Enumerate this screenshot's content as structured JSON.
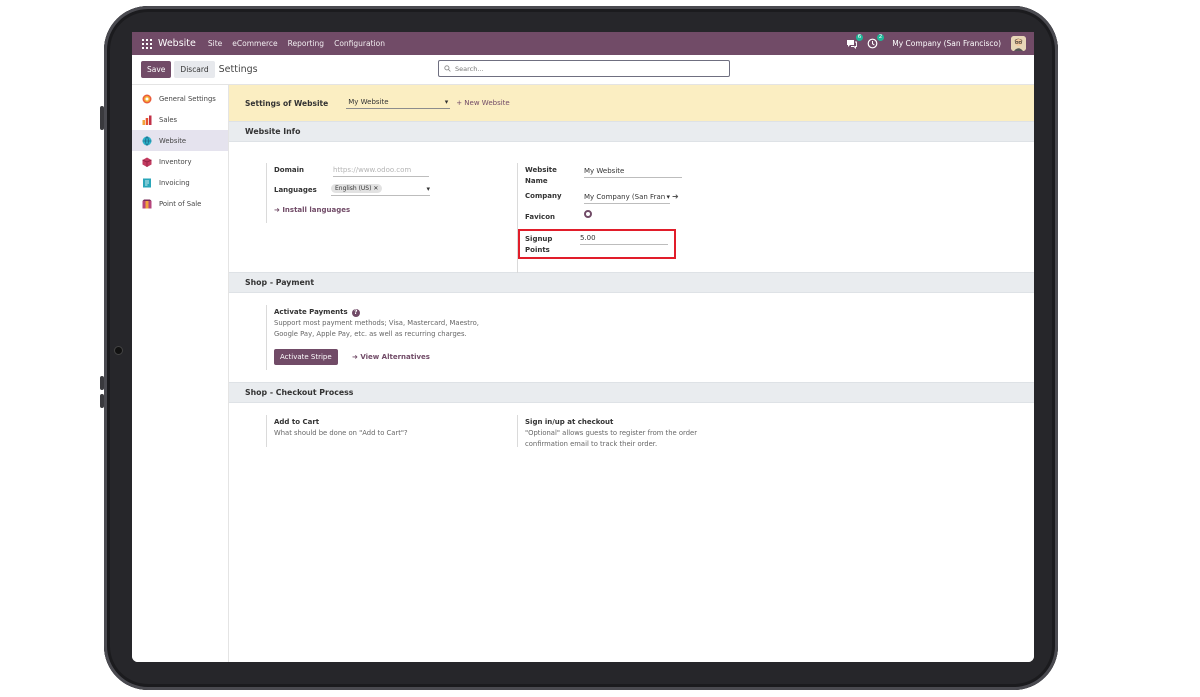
{
  "topnav": {
    "app_name": "Website",
    "menu": [
      "Site",
      "eCommerce",
      "Reporting",
      "Configuration"
    ],
    "chat_badge": "6",
    "activity_badge": "2",
    "company": "My Company (San Francisco)"
  },
  "control": {
    "save_label": "Save",
    "discard_label": "Discard",
    "breadcrumb": "Settings",
    "search_placeholder": "Search..."
  },
  "sidebar": {
    "items": [
      {
        "label": "General Settings",
        "color": "#e95d3c"
      },
      {
        "label": "Sales",
        "color": "#f2a33a"
      },
      {
        "label": "Website",
        "color": "#2ab3c9"
      },
      {
        "label": "Inventory",
        "color": "#c23a5f"
      },
      {
        "label": "Invoicing",
        "color": "#2aa6b9"
      },
      {
        "label": "Point of Sale",
        "color": "#b6457c"
      }
    ]
  },
  "website_bar": {
    "label": "Settings of Website",
    "selected": "My Website",
    "new_link": "+ New Website"
  },
  "website_info": {
    "title": "Website Info",
    "domain_label": "Domain",
    "domain_placeholder": "https://www.odoo.com",
    "languages_label": "Languages",
    "language_tag": "English (US)",
    "install_link": "Install languages",
    "website_name_label": "Website Name",
    "website_name": "My Website",
    "company_label": "Company",
    "company_value": "My Company (San Fran",
    "favicon_label": "Favicon",
    "signup_label": "Signup Points",
    "signup_value": "5.00"
  },
  "payment": {
    "title": "Shop - Payment",
    "activate_label": "Activate Payments",
    "desc_1": "Support most payment methods; Visa, Mastercard, Maestro,",
    "desc_2": "Google Pay, Apple Pay, etc. as well as recurring charges.",
    "stripe_button": "Activate Stripe",
    "alternatives_link": "View Alternatives"
  },
  "checkout": {
    "title": "Shop - Checkout Process",
    "add_to_cart_label": "Add to Cart",
    "add_to_cart_desc": "What should be done on \"Add to Cart\"?",
    "signin_label": "Sign in/up at checkout",
    "signin_desc_1": "\"Optional\" allows guests to register from the order",
    "signin_desc_2": "confirmation email to track their order."
  },
  "colors": {
    "brand": "#714b67",
    "highlight": "#e11d2a",
    "banner": "#fbeec2"
  }
}
